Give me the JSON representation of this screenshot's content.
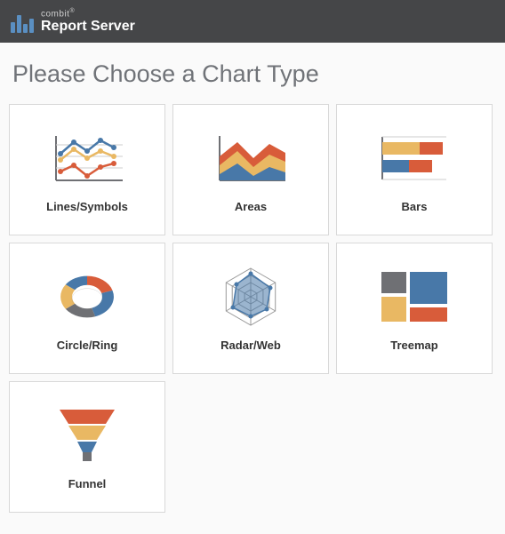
{
  "header": {
    "brand": "combit",
    "brand_sup": "®",
    "product": "Report Server"
  },
  "page_title": "Please Choose a Chart Type",
  "tiles": [
    {
      "label": "Lines/Symbols"
    },
    {
      "label": "Areas"
    },
    {
      "label": "Bars"
    },
    {
      "label": "Circle/Ring"
    },
    {
      "label": "Radar/Web"
    },
    {
      "label": "Treemap"
    },
    {
      "label": "Funnel"
    }
  ],
  "colors": {
    "blue": "#4878a8",
    "orange": "#d85c3a",
    "yellow": "#e9b863",
    "gray": "#6f7074"
  }
}
